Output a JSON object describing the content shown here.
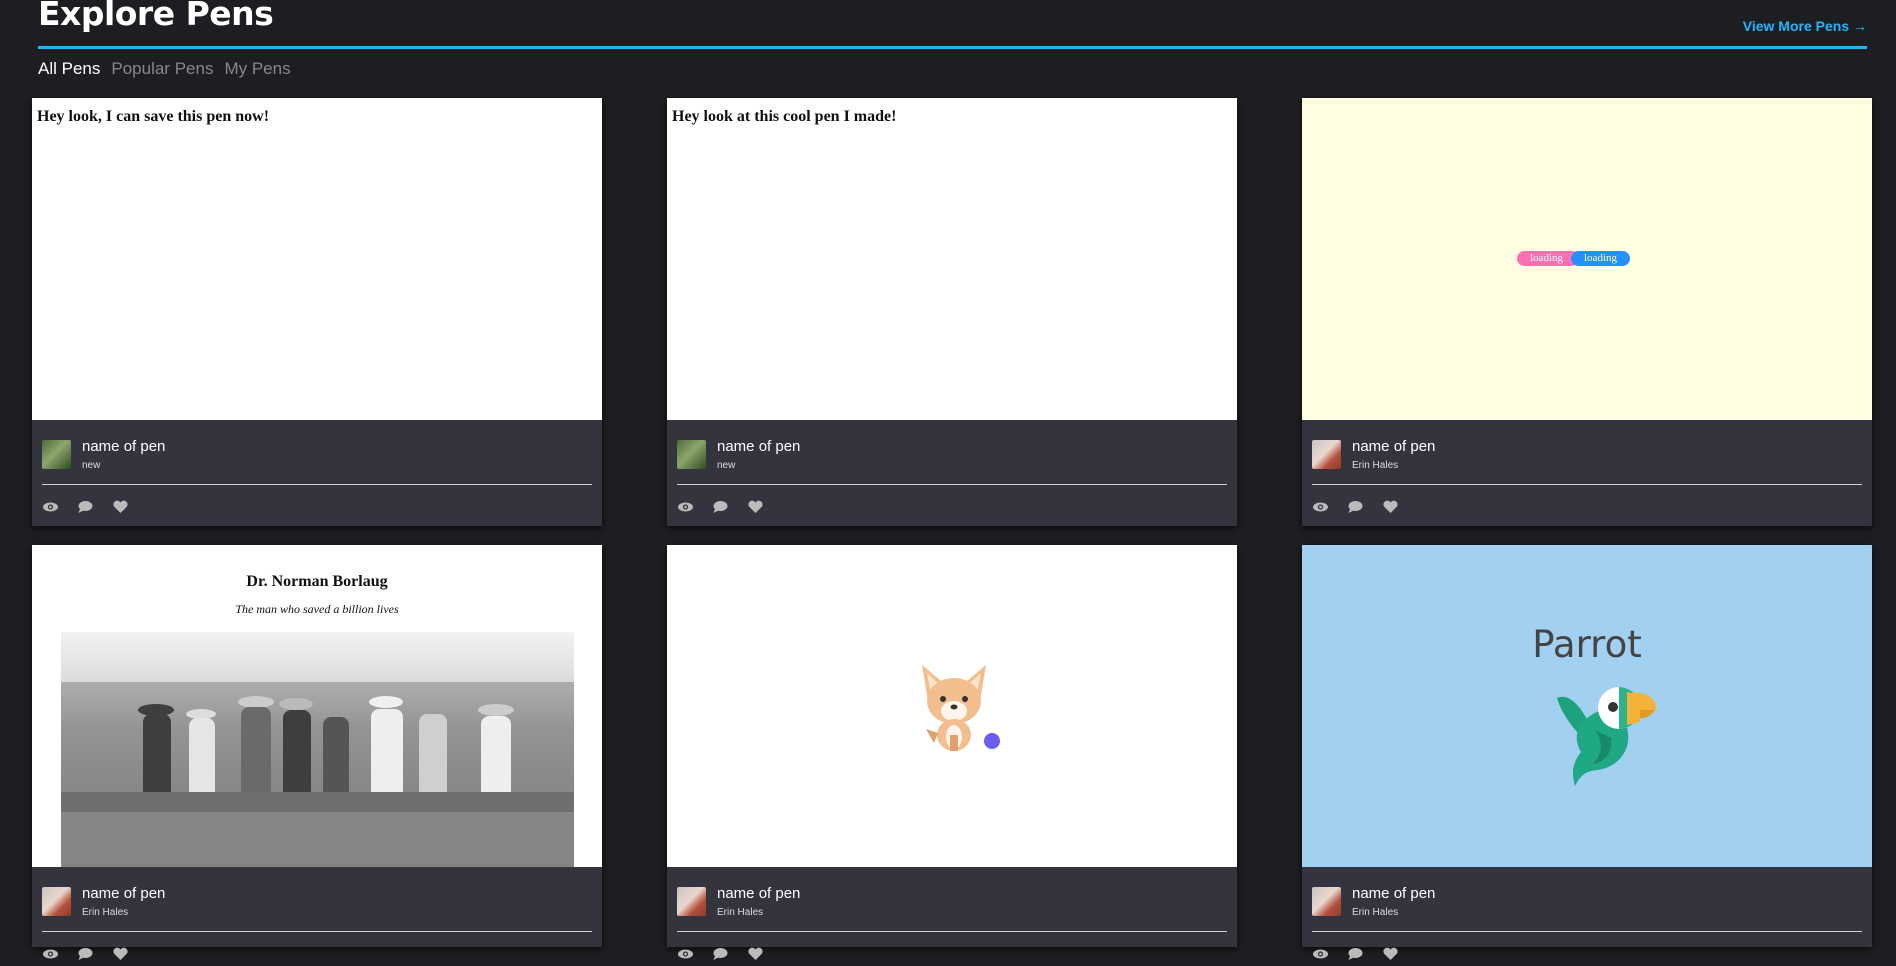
{
  "header": {
    "title": "Explore Pens",
    "view_more": "View More Pens →"
  },
  "tabs": [
    "All Pens",
    "Popular Pens",
    "My Pens"
  ],
  "cards": [
    {
      "preview_text": "Hey look, I can save this pen now!",
      "name": "name of pen",
      "author": "new"
    },
    {
      "preview_text": "Hey look at this cool pen I made!",
      "name": "name of pen",
      "author": "new"
    },
    {
      "loader": [
        "loading",
        "loading"
      ],
      "name": "name of pen",
      "author": "Erin Hales"
    },
    {
      "preview_title": "Dr. Norman Borlaug",
      "preview_subtitle": "The man who saved a billion lives",
      "name": "name of pen",
      "author": "Erin Hales"
    },
    {
      "name": "name of pen",
      "author": "Erin Hales"
    },
    {
      "preview_title": "Parrot",
      "name": "name of pen",
      "author": "Erin Hales"
    }
  ],
  "icons": [
    "eye-icon",
    "comment-icon",
    "heart-icon"
  ],
  "colors": {
    "accent": "#1fb6ff",
    "background": "#1d1e22",
    "card_footer": "#33343d",
    "pill_pink": "#ff6fb1",
    "pill_blue": "#2590ff",
    "yellow_preview": "#fefee0",
    "blue_preview": "#a2d0f1"
  }
}
